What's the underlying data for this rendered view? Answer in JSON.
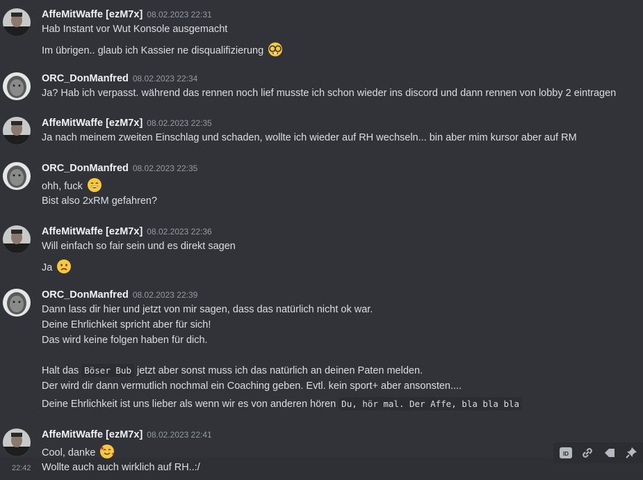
{
  "messages": [
    {
      "author": "AffeMitWaffe [ezM7x]",
      "timestamp": "08.02.2023 22:31",
      "avatar": "affe",
      "lines": [
        {
          "text": "Hab Instant vor Wut Konsole ausgemacht"
        },
        {
          "text": "Im übrigen.. glaub ich Kassier ne disqualifizierung",
          "emoji": "nerd-face-emoji"
        }
      ]
    },
    {
      "author": "ORC_DonManfred",
      "timestamp": "08.02.2023 22:34",
      "avatar": "orc",
      "lines": [
        {
          "text": "Ja? Hab ich verpasst. während das rennen noch lief musste ich schon wieder ins discord und dann rennen von lobby 2 eintragen"
        }
      ]
    },
    {
      "author": "AffeMitWaffe [ezM7x]",
      "timestamp": "08.02.2023 22:35",
      "avatar": "affe",
      "lines": [
        {
          "text": "Ja nach meinem zweiten Einschlag und schaden, wollte ich wieder auf RH wechseln... bin aber mim kursor aber auf RM"
        }
      ]
    },
    {
      "author": "ORC_DonManfred",
      "timestamp": "08.02.2023 22:35",
      "avatar": "orc",
      "lines": [
        {
          "text": "ohh, fuck",
          "emoji": "grinning-emoji"
        },
        {
          "text": "Bist also 2xRM gefahren?"
        }
      ]
    },
    {
      "author": "AffeMitWaffe [ezM7x]",
      "timestamp": "08.02.2023 22:36",
      "avatar": "affe",
      "lines": [
        {
          "text": "Will einfach so fair sein und es direkt sagen"
        },
        {
          "text": "Ja",
          "emoji": "frowning-emoji"
        }
      ]
    },
    {
      "author": "ORC_DonManfred",
      "timestamp": "08.02.2023 22:39",
      "avatar": "orc",
      "lines": [
        {
          "text": "Dann lass dir hier und jetzt von mir sagen, dass das natürlich nicht ok war."
        },
        {
          "text": "Deine Ehrlichkeit spricht aber für sich!"
        },
        {
          "text": "Das wird keine folgen haben für dich."
        },
        {
          "text": ""
        },
        {
          "pre": "Halt das ",
          "code": "Böser Bub",
          "post": " jetzt aber sonst muss ich das natürlich an deinen Paten melden."
        },
        {
          "text": "Der wird dir dann vermutlich nochmal ein Coaching geben. Evtl. kein sport+ aber ansonsten...."
        },
        {
          "pre": "Deine Ehrlichkeit ist uns lieber als wenn wir es von anderen hören ",
          "code": "Du, hör mal. Der Affe, bla bla bla",
          "post": ""
        }
      ]
    },
    {
      "author": "AffeMitWaffe [ezM7x]",
      "timestamp": "08.02.2023 22:41",
      "avatar": "affe",
      "lines": [
        {
          "text": "Cool, danke",
          "emoji": "smiling-hearts-emoji"
        }
      ]
    }
  ],
  "followup": {
    "time": "22:42",
    "text": "Wollte auch auch wirklich auf RH..:/"
  },
  "toolbar": {
    "actions": [
      "copy-id-icon",
      "copy-link-icon",
      "mark-unread-icon",
      "pin-icon"
    ]
  },
  "colors": {
    "background": "#313338",
    "author": "#f2f3f5",
    "timestamp": "#949ba4",
    "text": "#dbdee1",
    "code_bg": "#2b2d31",
    "hover_bg": "#2e3035"
  }
}
